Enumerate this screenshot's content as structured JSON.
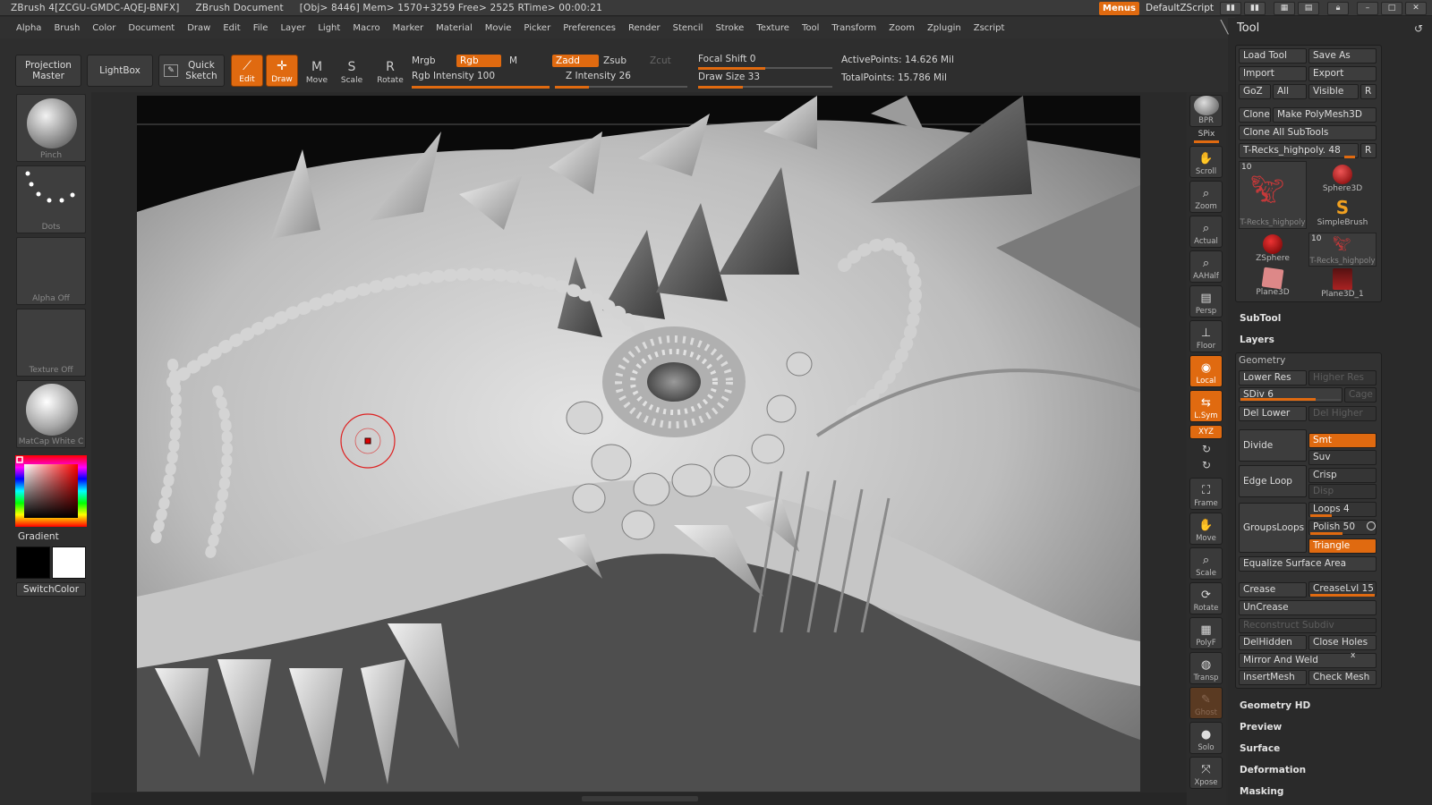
{
  "titlebar": {
    "app": "ZBrush 4[ZCGU-GMDC-AQEJ-BNFX]",
    "document": "ZBrush Document",
    "stats": "[Obj> 8446] Mem> 1570+3259  Free> 2525  RTime> 00:00:21",
    "menus_label": "Menus",
    "script_label": "DefaultZScript"
  },
  "menubar": [
    "Alpha",
    "Brush",
    "Color",
    "Document",
    "Draw",
    "Edit",
    "File",
    "Layer",
    "Light",
    "Macro",
    "Marker",
    "Material",
    "Movie",
    "Picker",
    "Preferences",
    "Render",
    "Stencil",
    "Stroke",
    "Texture",
    "Tool",
    "Transform",
    "Zoom",
    "Zplugin",
    "Zscript"
  ],
  "toolbar": {
    "projection_master": "Projection Master",
    "lightbox": "LightBox",
    "quick_sketch": "Quick Sketch",
    "edit": "Edit",
    "draw": "Draw",
    "move": "Move",
    "scale": "Scale",
    "rotate": "Rotate",
    "mrgb": "Mrgb",
    "rgb": "Rgb",
    "m": "M",
    "zadd": "Zadd",
    "zsub": "Zsub",
    "zcut": "Zcut",
    "rgb_intensity": "Rgb Intensity 100",
    "rgb_intensity_value": 100,
    "z_intensity": "Z Intensity 26",
    "z_intensity_value": 26,
    "focal_shift": "Focal Shift 0",
    "focal_shift_value": 0,
    "draw_size": "Draw Size 33",
    "draw_size_value": 33,
    "active_points": "ActivePoints: 14.626 Mil",
    "total_points": "TotalPoints: 15.786 Mil"
  },
  "lefttray": {
    "brush": "Pinch",
    "stroke": "Dots",
    "alpha": "Alpha Off",
    "texture": "Texture Off",
    "material": "MatCap White C",
    "gradient": "Gradient",
    "switch_color": "SwitchColor",
    "colors": {
      "main": "#000000",
      "secondary": "#ffffff"
    }
  },
  "rightshelf": {
    "bpr": "BPR",
    "spix": "SPix",
    "scroll": "Scroll",
    "zoom": "Zoom",
    "actual": "Actual",
    "aahalf": "AAHalf",
    "persp": "Persp",
    "floor": "Floor",
    "local": "Local",
    "lsym": "L.Sym",
    "xyz": "XYZ",
    "frame": "Frame",
    "move": "Move",
    "scale": "Scale",
    "rotate": "Rotate",
    "polyf": "PolyF",
    "transp": "Transp",
    "ghost": "Ghost",
    "solo": "Solo",
    "xpose": "Xpose"
  },
  "tool": {
    "title": "Tool",
    "load_tool": "Load Tool",
    "save_as": "Save As",
    "import": "Import",
    "export": "Export",
    "goz": "GoZ",
    "all": "All",
    "visible": "Visible",
    "r": "R",
    "clone": "Clone",
    "make_polymesh": "Make PolyMesh3D",
    "clone_all": "Clone All SubTools",
    "current_tool": "T-Recks_highpoly. 48",
    "subtools": [
      {
        "name": "T-Recks_highpoly",
        "count": "10"
      },
      {
        "name": "Sphere3D",
        "count": ""
      },
      {
        "name": "SimpleBrush",
        "count": ""
      },
      {
        "name": "ZSphere",
        "count": ""
      },
      {
        "name": "T-Recks_highpoly",
        "count": "10"
      },
      {
        "name": "Plane3D",
        "count": ""
      },
      {
        "name": "Plane3D_1",
        "count": ""
      }
    ],
    "subtool": "SubTool",
    "layers": "Layers",
    "geometry": "Geometry",
    "lower_res": "Lower Res",
    "higher_res": "Higher Res",
    "sdiv": "SDiv 6",
    "sdiv_value": 6,
    "cage": "Cage",
    "del_lower": "Del Lower",
    "del_higher": "Del Higher",
    "divide": "Divide",
    "smt": "Smt",
    "suv": "Suv",
    "edge_loop": "Edge Loop",
    "crisp": "Crisp",
    "disp": "Disp",
    "groups_loops": "GroupsLoops",
    "loops": "Loops 4",
    "loops_value": 4,
    "polish": "Polish 50",
    "polish_value": 50,
    "triangle": "Triangle",
    "equalize": "Equalize Surface Area",
    "crease": "Crease",
    "crease_lvl": "CreaseLvl 15",
    "crease_lvl_value": 15,
    "uncrease": "UnCrease",
    "reconstruct": "Reconstruct Subdiv",
    "del_hidden": "DelHidden",
    "close_holes": "Close Holes",
    "mirror_weld": "Mirror And Weld",
    "insert_mesh": "InsertMesh",
    "check_mesh": "Check Mesh",
    "geometry_hd": "Geometry HD",
    "preview": "Preview",
    "surface": "Surface",
    "deformation": "Deformation",
    "masking": "Masking"
  }
}
